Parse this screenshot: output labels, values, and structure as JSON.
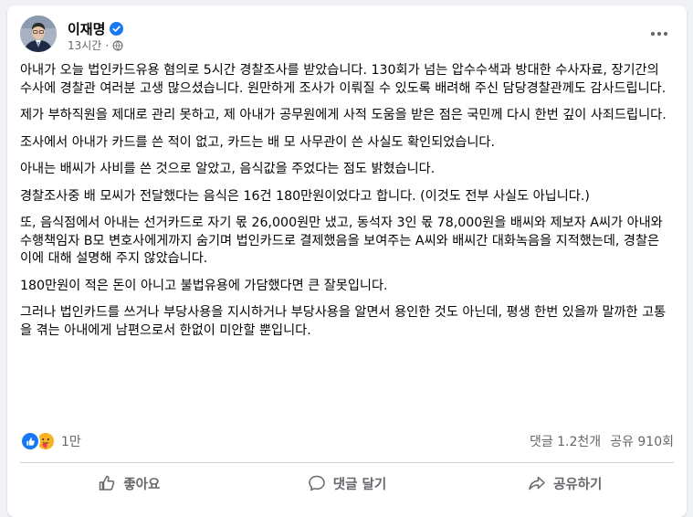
{
  "post": {
    "author": "이재명",
    "verified_icon": "verified-badge-icon",
    "time": "13시간",
    "dot": "·",
    "privacy_icon": "globe-icon",
    "more_icon": "more-horizontal-icon",
    "paragraphs": [
      "아내가 오늘 법인카드유용 혐의로 5시간 경찰조사를 받았습니다. 130회가 넘는 압수수색과 방대한 수사자료, 장기간의 수사에 경찰관 여러분 고생 많으셨습니다. 원만하게 조사가 이뤄질 수 있도록 배려해 주신 담당경찰관께도 감사드립니다.",
      "제가 부하직원을 제대로 관리 못하고, 제 아내가 공무원에게 사적 도움을 받은 점은 국민께 다시 한번 깊이 사죄드립니다.",
      "조사에서 아내가 카드를 쓴 적이 없고, 카드는 배 모 사무관이 쓴 사실도 확인되었습니다.",
      "아내는 배씨가 사비를 쓴 것으로 알았고, 음식값을 주었다는 점도 밝혔습니다.",
      "경찰조사중 배 모씨가 전달했다는 음식은 16건 180만원이었다고 합니다. (이것도 전부 사실도 아닙니다.)",
      "또, 음식점에서 아내는 선거카드로 자기 몫 26,000원만 냈고, 동석자 3인 몫 78,000원을 배씨와 제보자 A씨가 아내와 수행책임자 B모 변호사에게까지 숨기며 법인카드로 결제했음을 보여주는 A씨와 배씨간 대화녹음을 지적했는데, 경찰은 이에 대해 설명해 주지 않았습니다.",
      "180만원이 적은 돈이 아니고 불법유용에 가담했다면 큰 잘못입니다.",
      "그러나 법인카드를 쓰거나 부당사용을 지시하거나 부당사용을 알면서 용인한 것도 아닌데, 평생 한번 있을까 말까한 고통을 겪는 아내에게 남편으로서 한없이 미안할 뿐입니다."
    ]
  },
  "stats": {
    "reaction_icons": [
      "like-reaction-icon",
      "care-reaction-icon"
    ],
    "reaction_count": "1만",
    "comments": "댓글 1.2천개",
    "shares": "공유 910회"
  },
  "actions": {
    "like": "좋아요",
    "comment": "댓글 달기",
    "share": "공유하기"
  },
  "colors": {
    "accent": "#1877f2",
    "secondary_text": "#65676b",
    "background": "#f0f2f5"
  }
}
